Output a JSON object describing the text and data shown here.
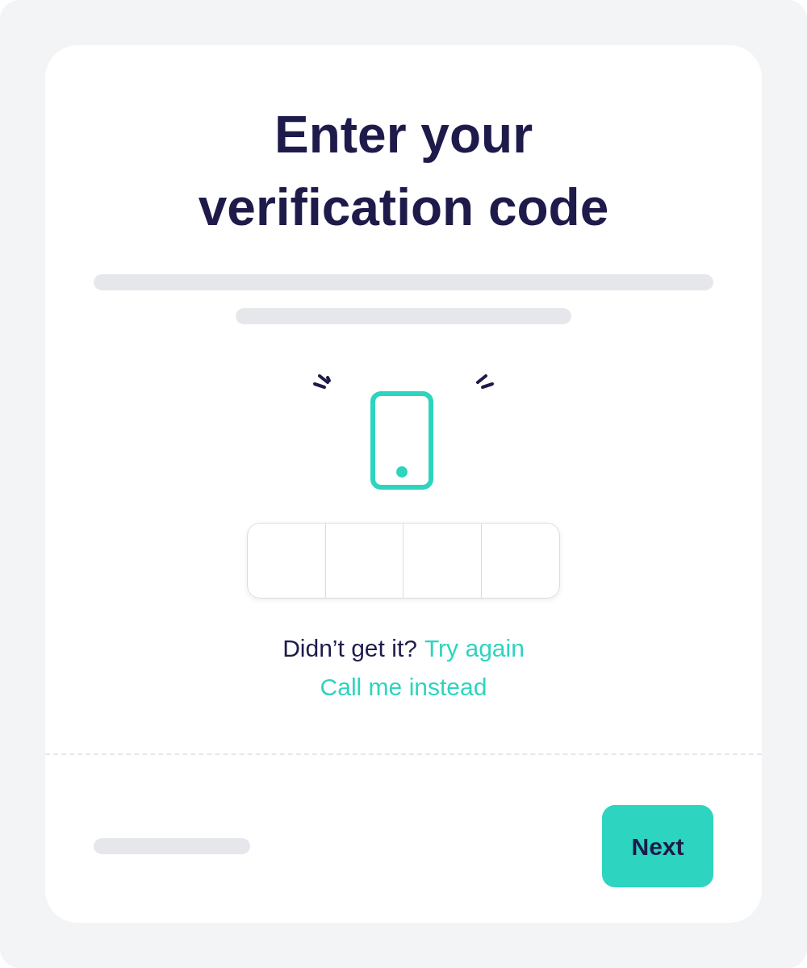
{
  "title_lines": [
    "Enter your",
    "verification code"
  ],
  "resend": {
    "prompt": "Didn’t get it?",
    "link": "Try again"
  },
  "call_link": "Call me instead",
  "next_button": {
    "label": "Next"
  }
}
